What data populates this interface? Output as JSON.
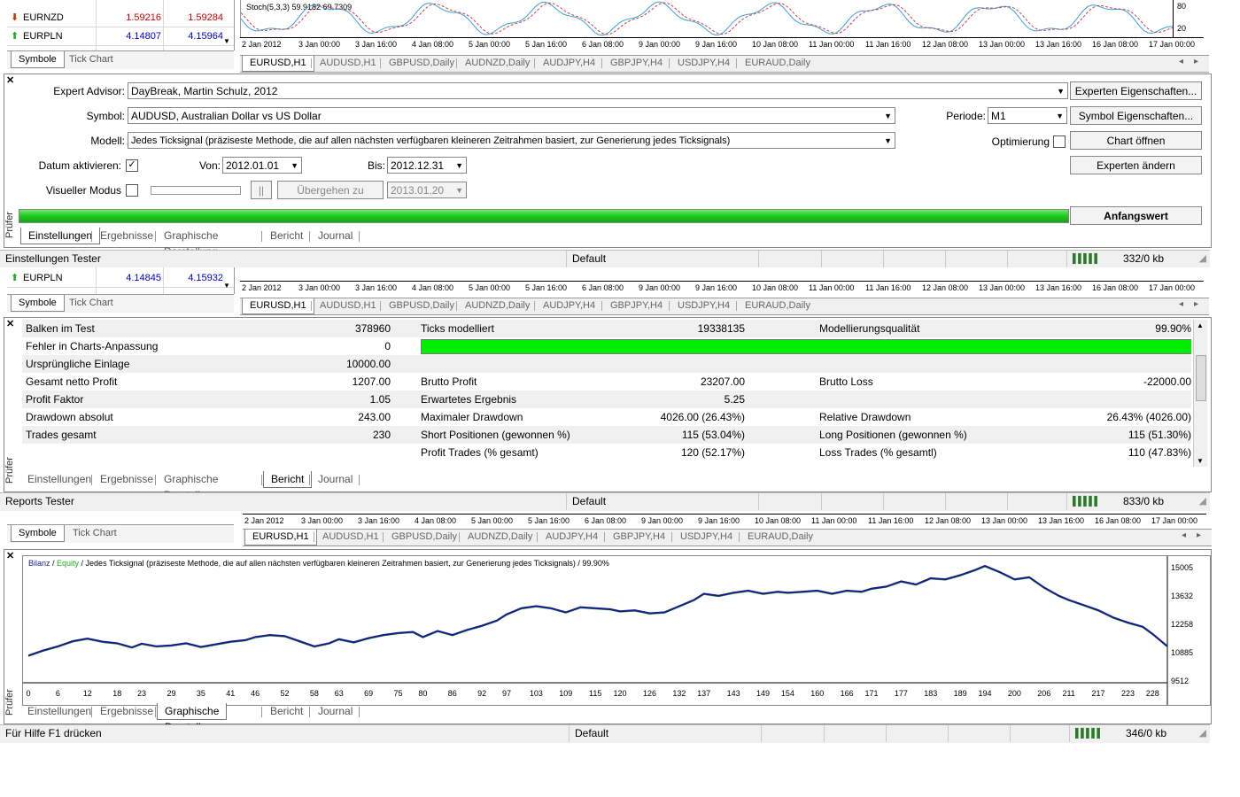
{
  "top": {
    "indicator_label": "Stoch(5,3,3) 59.9182 69.7309",
    "axis_levels": [
      "80",
      "20"
    ],
    "market_watch": [
      {
        "symbol": "EURNZD",
        "bid": "1.59216",
        "ask": "1.59284",
        "dir": "down"
      },
      {
        "symbol": "EURPLN",
        "bid": "4.14807",
        "ask": "4.15964",
        "dir": "up"
      }
    ]
  },
  "time_axis": [
    "2 Jan 2012",
    "3 Jan 00:00",
    "3 Jan 16:00",
    "4 Jan 08:00",
    "5 Jan 00:00",
    "5 Jan 16:00",
    "6 Jan 08:00",
    "9 Jan 00:00",
    "9 Jan 16:00",
    "10 Jan 08:00",
    "11 Jan 00:00",
    "11 Jan 16:00",
    "12 Jan 08:00",
    "13 Jan 00:00",
    "13 Jan 16:00",
    "16 Jan 08:00",
    "17 Jan 00:00"
  ],
  "mw_tabs": [
    "Symbole",
    "Tick Chart"
  ],
  "chart_tabs": [
    "EURUSD,H1",
    "AUDUSD,H1",
    "GBPUSD,Daily",
    "AUDNZD,Daily",
    "AUDJPY,H4",
    "GBPJPY,H4",
    "USDJPY,H4",
    "EURAUD,Daily"
  ],
  "tester_tabs": [
    "Einstellungen",
    "Ergebnisse",
    "Graphische Darstellung",
    "Bericht",
    "Journal"
  ],
  "tester_side_label": "Prüfer",
  "settings": {
    "ea_label": "Expert Advisor:",
    "ea_value": "DayBreak, Martin Schulz, 2012",
    "symbol_label": "Symbol:",
    "symbol_value": "AUDUSD, Australian Dollar vs US Dollar",
    "model_label": "Modell:",
    "model_value": "Jedes  Ticksignal (präziseste Methode, die auf allen nächsten verfügbaren kleineren Zeitrahmen basiert, zur Generierung jedes Ticksignals)",
    "date_label": "Datum aktivieren:",
    "date_checked": "✓",
    "from_label": "Von:",
    "from_value": "2012.01.01",
    "to_label": "Bis:",
    "to_value": "2012.12.31",
    "visual_label": "Visueller Modus",
    "pause_label": "||",
    "skip_label": "Übergehen zu",
    "skip_date": "2013.01.20",
    "period_label": "Periode:",
    "period_value": "M1",
    "optim_label": "Optimierung",
    "btn_expert_props": "Experten Eigenschaften...",
    "btn_symbol_props": "Symbol Eigenschaften...",
    "btn_open_chart": "Chart öffnen",
    "btn_modify_expert": "Experten ändern",
    "btn_start": "Anfangswert",
    "progress": 1.0
  },
  "status1": {
    "text": "Einstellungen Tester",
    "profile": "Default",
    "kb": "332/0 kb"
  },
  "mid": {
    "market_watch": [
      {
        "symbol": "EURPLN",
        "bid": "4.14845",
        "ask": "4.15932",
        "dir": "up"
      }
    ]
  },
  "report": {
    "rows": [
      {
        "a": "Balken im Test",
        "av": "378960",
        "b": "Ticks modelliert",
        "bv": "19338135",
        "c": "Modellierungsqualität",
        "cv": "99.90%"
      },
      {
        "a": "Fehler in Charts-Anpassung",
        "av": "0",
        "b": "",
        "bv": "",
        "c": "",
        "cv": ""
      },
      {
        "a": "Ursprüngliche Einlage",
        "av": "10000.00",
        "b": "",
        "bv": "",
        "c": "",
        "cv": ""
      },
      {
        "a": "Gesamt netto Profit",
        "av": "1207.00",
        "b": "Brutto Profit",
        "bv": "23207.00",
        "c": "Brutto Loss",
        "cv": "-22000.00"
      },
      {
        "a": "Profit Faktor",
        "av": "1.05",
        "b": "Erwartetes Ergebnis",
        "bv": "5.25",
        "c": "",
        "cv": ""
      },
      {
        "a": "Drawdown absolut",
        "av": "243.00",
        "b": "Maximaler Drawdown",
        "bv": "4026.00 (26.43%)",
        "c": "Relative Drawdown",
        "cv": "26.43% (4026.00)"
      },
      {
        "a": "Trades gesamt",
        "av": "230",
        "b": "Short Positionen (gewonnen %)",
        "bv": "115 (53.04%)",
        "c": "Long Positionen (gewonnen %)",
        "cv": "115 (51.30%)"
      },
      {
        "a": "",
        "av": "",
        "b": "Profit Trades (% gesamt)",
        "bv": "120 (52.17%)",
        "c": "Loss Trades (% gesamtl)",
        "cv": "110 (47.83%)"
      }
    ],
    "quality_fill": 0.999
  },
  "status2": {
    "text": "Reports Tester",
    "profile": "Default",
    "kb": "833/0 kb"
  },
  "graph": {
    "legend_balance": "Bilanz",
    "legend_sep": " / ",
    "legend_equity": "Equity",
    "legend_rest": " / Jedes  Ticksignal (präziseste Methode, die auf allen nächsten verfügbaren kleineren Zeitrahmen basiert, zur Generierung jedes Ticksignals) / 99.90%"
  },
  "chart_data": {
    "type": "line",
    "series": [
      {
        "name": "Bilanz",
        "color": "#1a1a8c"
      },
      {
        "name": "Equity",
        "color": "#22aa22"
      }
    ],
    "x_ticks": [
      0,
      6,
      12,
      18,
      23,
      29,
      35,
      41,
      46,
      52,
      58,
      63,
      69,
      75,
      80,
      86,
      92,
      97,
      103,
      109,
      115,
      120,
      126,
      132,
      137,
      143,
      149,
      154,
      160,
      166,
      171,
      177,
      183,
      189,
      194,
      200,
      206,
      211,
      217,
      223,
      228
    ],
    "y_ticks": [
      15005,
      13632,
      12258,
      10885,
      9512
    ],
    "ylim": [
      9512,
      15005
    ],
    "xlim": [
      0,
      231
    ],
    "x": [
      0,
      3,
      6,
      9,
      12,
      15,
      18,
      21,
      23,
      26,
      29,
      32,
      35,
      38,
      41,
      44,
      46,
      49,
      52,
      55,
      58,
      61,
      63,
      66,
      69,
      72,
      75,
      78,
      80,
      83,
      86,
      89,
      92,
      95,
      97,
      100,
      103,
      106,
      109,
      112,
      115,
      118,
      120,
      123,
      126,
      129,
      132,
      135,
      137,
      140,
      143,
      146,
      149,
      152,
      154,
      157,
      160,
      163,
      166,
      169,
      171,
      174,
      177,
      180,
      183,
      186,
      189,
      192,
      194,
      197,
      200,
      203,
      206,
      209,
      211,
      214,
      217,
      220,
      223,
      226,
      228,
      231
    ],
    "y": [
      10700,
      10950,
      11150,
      11400,
      11530,
      11380,
      11300,
      11100,
      11280,
      11150,
      11200,
      11300,
      11120,
      11250,
      11380,
      11450,
      11600,
      11700,
      11650,
      11400,
      11150,
      11300,
      11500,
      11350,
      11550,
      11700,
      11800,
      11850,
      11600,
      11900,
      11700,
      11950,
      12150,
      12400,
      12700,
      13000,
      13100,
      13000,
      12800,
      13050,
      13000,
      12950,
      12850,
      12900,
      12750,
      12800,
      13100,
      13400,
      13700,
      13600,
      13750,
      13850,
      13700,
      13800,
      13750,
      13800,
      13850,
      13700,
      13850,
      13800,
      13950,
      14050,
      14300,
      14150,
      14450,
      14400,
      14600,
      14850,
      15050,
      14750,
      14400,
      14500,
      14000,
      13600,
      13400,
      13150,
      12900,
      12550,
      12300,
      12100,
      11750,
      11150
    ]
  },
  "status3": {
    "text": "Für Hilfe F1 drücken",
    "profile": "Default",
    "kb": "346/0 kb"
  }
}
